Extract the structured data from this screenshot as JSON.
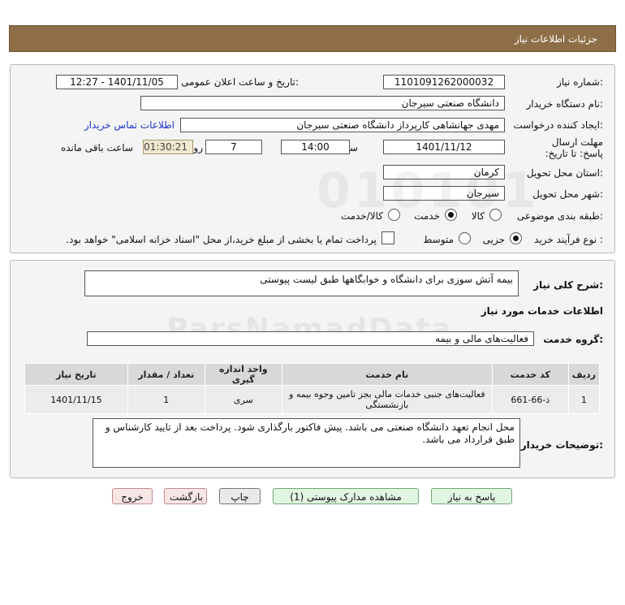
{
  "header": {
    "title": "جزئیات اطلاعات نیاز"
  },
  "form": {
    "need_number": {
      "label": "شماره نیاز:",
      "value": "1101091262000032"
    },
    "announce": {
      "label": "تاریخ و ساعت اعلان عمومی:",
      "value": "1401/11/05 - 12:27"
    },
    "buyer_org": {
      "label": "نام دستگاه خریدار:",
      "value": "دانشگاه صنعتی سیرجان"
    },
    "requester": {
      "label": "ایجاد کننده درخواست:",
      "value": "مهدی جهانشاهی کارپرداز دانشگاه صنعتی سیرجان",
      "contact_link": "اطلاعات تماس خریدار"
    },
    "deadline": {
      "label": "مهلت ارسال پاسخ: تا تاریخ:",
      "date": "1401/11/12",
      "time_label": "ساعت",
      "time": "14:00",
      "days": "7",
      "days_label": "روز و",
      "remaining": "01:30:21",
      "remaining_label": "ساعت باقی مانده"
    },
    "province": {
      "label": "استان محل تحویل:",
      "value": "کرمان"
    },
    "city": {
      "label": "شهر محل تحویل:",
      "value": "سیرجان"
    },
    "category": {
      "label": "طبقه بندی موضوعی:",
      "options": [
        "کالا",
        "خدمت",
        "کالا/خدمت"
      ],
      "selected": "خدمت"
    },
    "process": {
      "label": "نوع فرآیند خرید :",
      "options": [
        "جزیی",
        "متوسط"
      ],
      "selected": "جزیی",
      "payment_note": "پرداخت تمام یا بخشی از مبلغ خرید،از محل \"اسناد خزانه اسلامی\" خواهد بود."
    }
  },
  "summary": {
    "label": "شرح کلی نیاز:",
    "value": "بیمه آتش سوزی برای دانشگاه و خوابگاهها طبق لیست پیوستی"
  },
  "services": {
    "section_title": "اطلاعات خدمات مورد نیاز",
    "group_label": "گروه خدمت:",
    "group_value": "فعالیت‌های مالی و بیمه",
    "columns": [
      "ردیف",
      "کد خدمت",
      "نام خدمت",
      "واحد اندازه گیری",
      "تعداد / مقدار",
      "تاریخ نیاز"
    ],
    "rows": [
      {
        "index": "1",
        "code": "ذ-66-661",
        "name": "فعالیت‌های جنبی خدمات مالی بجز تامین وجوه بیمه و بازنشستگی",
        "unit": "سری",
        "qty": "1",
        "date": "1401/11/15"
      }
    ]
  },
  "buyer_notes": {
    "label": "توضیحات خریدار:",
    "value": "محل انجام تعهد دانشگاه صنعتی می باشد. پیش فاکتور بارگذاری شود. پرداخت بعد از تایید کارشناس و طبق قرارداد می باشد."
  },
  "buttons": {
    "reply": "پاسخ به نیاز",
    "attachments": "مشاهده مدارک پیوستی (1)",
    "print": "چاپ",
    "back": "بازگشت",
    "exit": "خروج"
  },
  "watermark": {
    "line1": "ParsNamadData"
  },
  "colors": {
    "header_bg": "#8e6e46",
    "link": "#1a33cc",
    "timer_bg": "#efe9cf"
  }
}
